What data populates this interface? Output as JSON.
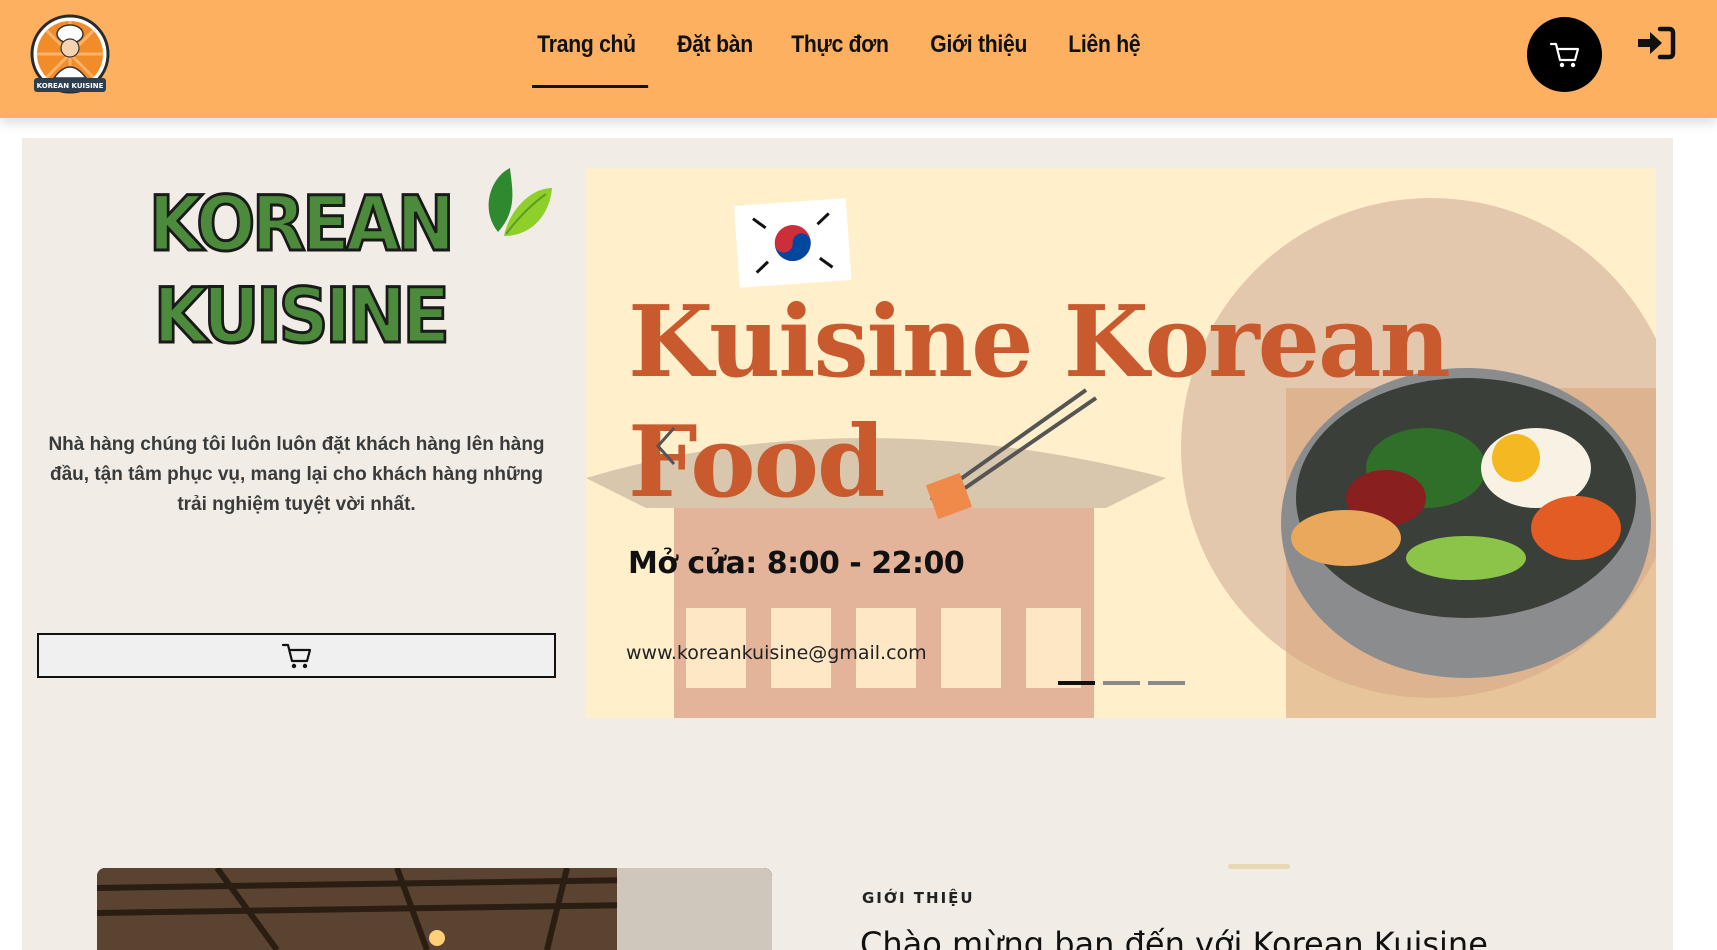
{
  "header": {
    "logo_text": "KOREAN KUISINE",
    "nav": [
      {
        "label": "Trang chủ",
        "active": true
      },
      {
        "label": "Đặt bàn",
        "active": false
      },
      {
        "label": "Thực đơn",
        "active": false
      },
      {
        "label": "Giới thiệu",
        "active": false
      },
      {
        "label": "Liên hệ",
        "active": false
      }
    ],
    "cart_icon": "cart-icon",
    "login_icon": "sign-in-icon",
    "bg_color": "#fdb05f"
  },
  "hero": {
    "brand_line1": "KOREAN",
    "brand_line2": "KUISINE",
    "brand_color": "#4b8b3b",
    "tagline": "Nhà hàng chúng tôi luôn luôn đặt khách hàng lên hàng đầu, tận tâm phục vụ, mang lại cho khách hàng những trải nghiệm tuyệt vời nhất.",
    "order_button_icon": "cart-icon"
  },
  "banner": {
    "title_line1": "Kuisine Korean",
    "title_line2": "Food",
    "hours": "Mở cửa: 8:00 - 22:00",
    "email": "www.koreankuisine@gmail.com",
    "slide_count": 3,
    "active_slide": 1,
    "title_color": "#c85a2e"
  },
  "about": {
    "label": "GIỚI THIỆU",
    "heading": "Chào mừng bạn đến với Korean Kuisine"
  }
}
